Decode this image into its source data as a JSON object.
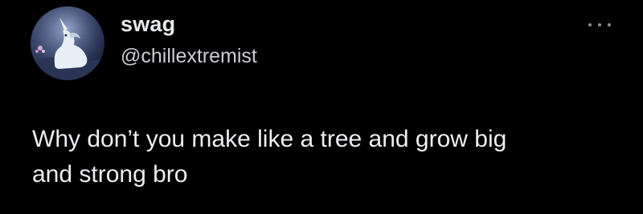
{
  "tweet": {
    "author": {
      "display_name": "swag",
      "handle": "@chillextremist",
      "avatar_icon": "unicorn-avatar-icon"
    },
    "menu_icon": "more-options-icon",
    "text_lines": [
      "Why don’t you make like a tree and grow big",
      "and strong bro"
    ]
  },
  "colors": {
    "background": "#000000",
    "primary_text": "#e7e9ea",
    "secondary_text": "#c9cdd1",
    "icon_gray": "#8a8f94"
  }
}
